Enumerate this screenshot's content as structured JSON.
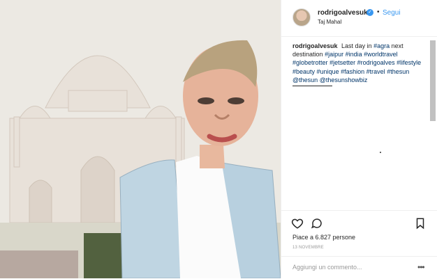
{
  "post": {
    "username": "rodrigoalvesuk",
    "follow_label": "Segui",
    "location": "Taj Mahal",
    "caption": {
      "username": "rodrigoalvesuk",
      "text": "Last day in",
      "hashtags": [
        "#agra",
        "next destination",
        "#jaipur",
        "#india",
        "#worldtravel",
        "#globetrotter",
        "#jetsetter",
        "#rodrigoalves",
        "#lifestyle",
        "#beauty",
        "#unique",
        "#fashion",
        "#travel",
        "#thesun",
        "@thesun",
        "@thesunshowbiz"
      ]
    },
    "likes": "Piace a 6.827 persone",
    "date": "13 NOVEMBRE",
    "comment_placeholder": "Aggiungi un commento...",
    "more_label": "•••"
  },
  "icons": {
    "verified": "verified-badge-icon",
    "heart": "heart-icon",
    "comment": "comment-icon",
    "bookmark": "bookmark-icon"
  },
  "colors": {
    "link": "#3897f0",
    "hashtag": "#003569",
    "border": "#efefef"
  }
}
